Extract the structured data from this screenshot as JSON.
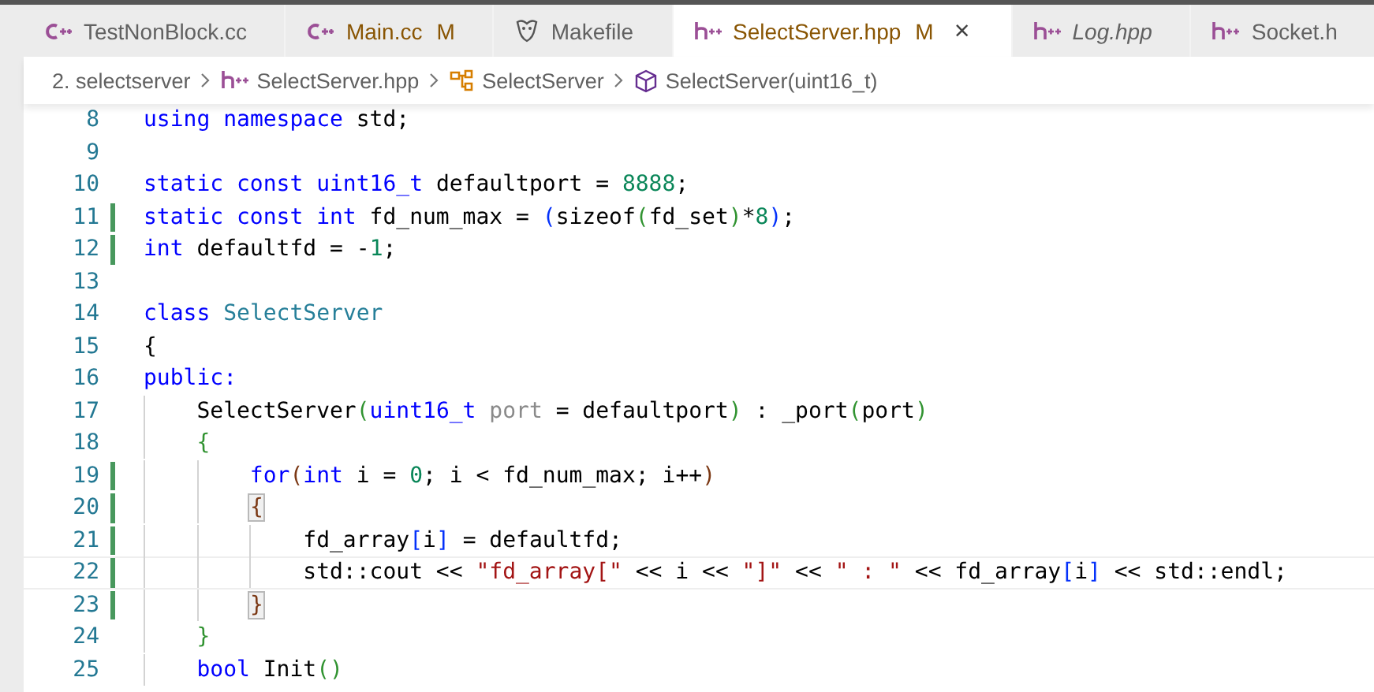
{
  "tabs": [
    {
      "kind": "cpp",
      "label": "TestNonBlock.cc",
      "modified": false,
      "italic": false,
      "selected": false
    },
    {
      "kind": "cpp",
      "label": "Main.cc",
      "badge": "M",
      "modified": true,
      "italic": false,
      "selected": false
    },
    {
      "kind": "makefile",
      "label": "Makefile",
      "modified": false,
      "italic": false,
      "selected": false
    },
    {
      "kind": "hpp",
      "label": "SelectServer.hpp",
      "badge": "M",
      "modified": true,
      "italic": false,
      "selected": true,
      "close": "×"
    },
    {
      "kind": "hpp",
      "label": "Log.hpp",
      "modified": false,
      "italic": true,
      "selected": false
    },
    {
      "kind": "hpp",
      "label": "Socket.h",
      "modified": false,
      "italic": false,
      "selected": false
    }
  ],
  "breadcrumb": [
    {
      "kind": "folder",
      "label": "2. selectserver"
    },
    {
      "kind": "hpp",
      "label": "SelectServer.hpp"
    },
    {
      "kind": "class",
      "label": "SelectServer"
    },
    {
      "kind": "method",
      "label": "SelectServer(uint16_t)"
    }
  ],
  "lines": [
    {
      "number": "8",
      "changed": false,
      "current": false,
      "tokens": [
        {
          "t": "using",
          "kind": "kw"
        },
        {
          "t": " namespace",
          "kind": "kw"
        },
        {
          "t": " std;",
          "kind": "plain"
        }
      ]
    },
    {
      "number": "9",
      "changed": false,
      "current": false
    },
    {
      "number": "10",
      "changed": false,
      "current": false,
      "tokens": [
        {
          "t": "static const uint16_t",
          "kind": "kw"
        },
        {
          "t": " defaultport = ",
          "kind": "plain"
        },
        {
          "t": "8888",
          "kind": "num"
        },
        {
          "t": ";",
          "kind": "plain"
        }
      ]
    },
    {
      "number": "11",
      "changed": true,
      "current": false,
      "tokens": [
        {
          "t": "static const int",
          "kind": "kw"
        },
        {
          "t": " fd_num_max = ",
          "kind": "plain"
        },
        {
          "t": "(",
          "kind": "b1"
        },
        {
          "t": "sizeof",
          "kind": "plain"
        },
        {
          "t": "(",
          "kind": "b2"
        },
        {
          "t": "fd_set",
          "kind": "plain"
        },
        {
          "t": ")",
          "kind": "b2"
        },
        {
          "t": "*",
          "kind": "plain"
        },
        {
          "t": "8",
          "kind": "num"
        },
        {
          "t": ")",
          "kind": "b1"
        },
        {
          "t": ";",
          "kind": "plain"
        }
      ]
    },
    {
      "number": "12",
      "changed": true,
      "current": false,
      "tokens": [
        {
          "t": "int",
          "kind": "kw"
        },
        {
          "t": " defaultfd = -",
          "kind": "plain"
        },
        {
          "t": "1",
          "kind": "num"
        },
        {
          "t": ";",
          "kind": "plain"
        }
      ]
    },
    {
      "number": "13",
      "changed": false,
      "current": false
    },
    {
      "number": "14",
      "changed": false,
      "current": false,
      "tokens": [
        {
          "t": "class",
          "kind": "kw"
        },
        {
          "t": " SelectServer",
          "kind": "cls"
        }
      ]
    },
    {
      "number": "15",
      "changed": false,
      "current": false,
      "tokens": [
        {
          "t": "{",
          "kind": "plain"
        }
      ]
    },
    {
      "number": "16",
      "changed": false,
      "current": false,
      "tokens": [
        {
          "t": "public:",
          "kind": "kw"
        }
      ]
    },
    {
      "number": "17",
      "changed": false,
      "current": false,
      "tokens": [
        {
          "t": "    SelectServer",
          "kind": "plain"
        },
        {
          "t": "(",
          "kind": "b2"
        },
        {
          "t": "uint16_t",
          "kind": "kw"
        },
        {
          "t": " port",
          "kind": "param"
        },
        {
          "t": " = defaultport",
          "kind": "plain"
        },
        {
          "t": ")",
          "kind": "b2"
        },
        {
          "t": " : _port",
          "kind": "plain"
        },
        {
          "t": "(",
          "kind": "b2"
        },
        {
          "t": "port",
          "kind": "plain"
        },
        {
          "t": ")",
          "kind": "b2"
        }
      ]
    },
    {
      "number": "18",
      "changed": false,
      "current": false,
      "tokens": [
        {
          "t": "    {",
          "kind": "b2"
        }
      ]
    },
    {
      "number": "19",
      "changed": true,
      "current": false,
      "tokens": [
        {
          "t": "        for",
          "kind": "kw"
        },
        {
          "t": "(",
          "kind": "b3"
        },
        {
          "t": "int",
          "kind": "kw"
        },
        {
          "t": " i = ",
          "kind": "plain"
        },
        {
          "t": "0",
          "kind": "num"
        },
        {
          "t": "; i < fd_num_max; i++",
          "kind": "plain"
        },
        {
          "t": ")",
          "kind": "b3"
        }
      ]
    },
    {
      "number": "20",
      "changed": true,
      "current": false,
      "tokens": [
        {
          "t": "        {",
          "kind": "b3",
          "matched": true
        }
      ]
    },
    {
      "number": "21",
      "changed": true,
      "current": false,
      "tokens": [
        {
          "t": "            fd_array",
          "kind": "plain"
        },
        {
          "t": "[",
          "kind": "b1"
        },
        {
          "t": "i",
          "kind": "plain"
        },
        {
          "t": "]",
          "kind": "b1"
        },
        {
          "t": " = defaultfd;",
          "kind": "plain"
        }
      ]
    },
    {
      "number": "22",
      "changed": true,
      "current": true,
      "tokens": [
        {
          "t": "            std::cout << ",
          "kind": "plain"
        },
        {
          "t": "\"fd_array[\"",
          "kind": "str"
        },
        {
          "t": " << i << ",
          "kind": "plain"
        },
        {
          "t": "\"]\"",
          "kind": "str"
        },
        {
          "t": " << ",
          "kind": "plain"
        },
        {
          "t": "\" : \"",
          "kind": "str"
        },
        {
          "t": " << fd_array",
          "kind": "plain"
        },
        {
          "t": "[",
          "kind": "b1"
        },
        {
          "t": "i",
          "kind": "plain"
        },
        {
          "t": "]",
          "kind": "b1"
        },
        {
          "t": " << std::endl;",
          "kind": "plain"
        }
      ]
    },
    {
      "number": "23",
      "changed": true,
      "current": false,
      "tokens": [
        {
          "t": "        }",
          "kind": "b3",
          "matched": true
        }
      ]
    },
    {
      "number": "24",
      "changed": false,
      "current": false,
      "tokens": [
        {
          "t": "    }",
          "kind": "b2"
        }
      ]
    },
    {
      "number": "25",
      "changed": false,
      "current": false,
      "tokens": [
        {
          "t": "    bool",
          "kind": "kw"
        },
        {
          "t": " Init",
          "kind": "plain"
        },
        {
          "t": "()",
          "kind": "b2"
        }
      ]
    }
  ]
}
